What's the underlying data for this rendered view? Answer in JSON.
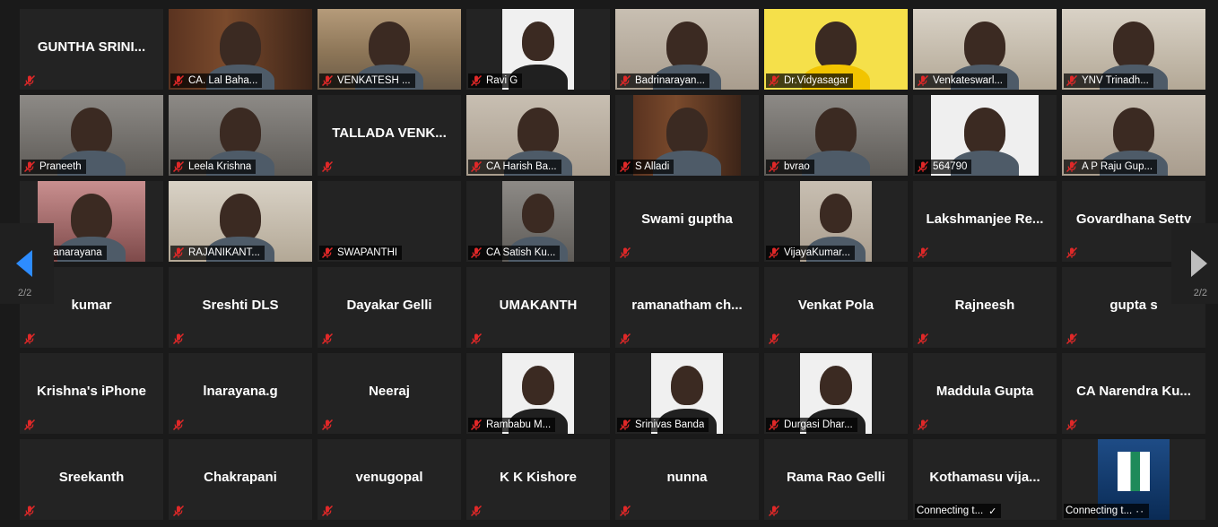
{
  "colors": {
    "background": "#1a1a1a",
    "tile": "#232323",
    "accent_arrow": "#2d8cff",
    "muted_mic": "#e02828"
  },
  "pager": {
    "left_page": "2/2",
    "right_page": "2/2"
  },
  "tiles": [
    {
      "name": "GUNTHA SRINI...",
      "label": "",
      "video": false
    },
    {
      "name": "CA. Lal Baha...",
      "label": "CA. Lal Baha...",
      "video": true,
      "scene": "scene-door"
    },
    {
      "name": "VENKATESH ...",
      "label": "VENKATESH ...",
      "video": true,
      "scene": "scene-shelf"
    },
    {
      "name": "Ravi G",
      "label": "Ravi G",
      "video": true,
      "scene": "scene-portrait",
      "narrow": true
    },
    {
      "name": "Badrinarayan...",
      "label": "Badrinarayan...",
      "video": true,
      "scene": "scene-wall"
    },
    {
      "name": "Dr.Vidyasagar",
      "label": "Dr.Vidyasagar",
      "video": true,
      "scene": "scene-yellow"
    },
    {
      "name": "Venkateswarl...",
      "label": "Venkateswarl...",
      "video": true,
      "scene": "scene-room"
    },
    {
      "name": "YNV Trinadh...",
      "label": "YNV Trinadh...",
      "video": true,
      "scene": "scene-room"
    },
    {
      "name": "Praneeth",
      "label": "Praneeth",
      "video": true,
      "scene": "scene-grey"
    },
    {
      "name": "Leela Krishna",
      "label": "Leela Krishna",
      "video": true,
      "scene": "scene-grey"
    },
    {
      "name": "TALLADA VENK...",
      "label": "",
      "video": false
    },
    {
      "name": "CA Harish Ba...",
      "label": "CA Harish Ba...",
      "video": true,
      "scene": "scene-wall"
    },
    {
      "name": "S Alladi",
      "label": "S Alladi",
      "video": true,
      "scene": "scene-door",
      "narrow": true,
      "wide_narrow": true
    },
    {
      "name": "bvrao",
      "label": "bvrao",
      "video": true,
      "scene": "scene-grey"
    },
    {
      "name": "564790",
      "label": "564790",
      "video": true,
      "scene": "scene-white",
      "narrow": true,
      "wide_narrow": true
    },
    {
      "name": "A P Raju Gup...",
      "label": "A P Raju Gup...",
      "video": true,
      "scene": "scene-wall"
    },
    {
      "name": "...yanarayana",
      "label": "...yanarayana",
      "video": true,
      "scene": "scene-pink",
      "narrow": true,
      "wide_narrow": true
    },
    {
      "name": "RAJANIKANT...",
      "label": "RAJANIKANT...",
      "video": true,
      "scene": "scene-room"
    },
    {
      "name": "SWAPANTHI",
      "label": "SWAPANTHI",
      "video": false,
      "no_big": true
    },
    {
      "name": "CA Satish Ku...",
      "label": "CA Satish Ku...",
      "video": true,
      "scene": "scene-grey",
      "narrow": true
    },
    {
      "name": "Swami guptha",
      "label": "",
      "video": false
    },
    {
      "name": "VijayaKumar...",
      "label": "VijayaKumar...",
      "video": true,
      "scene": "scene-wall",
      "narrow": true
    },
    {
      "name": "Lakshmanjee  Re...",
      "label": "",
      "video": false
    },
    {
      "name": "Govardhana Setty",
      "label": "",
      "video": false
    },
    {
      "name": "kumar",
      "label": "",
      "video": false
    },
    {
      "name": "Sreshti DLS",
      "label": "",
      "video": false
    },
    {
      "name": "Dayakar Gelli",
      "label": "",
      "video": false
    },
    {
      "name": "UMAKANTH",
      "label": "",
      "video": false
    },
    {
      "name": "ramanatham  ch...",
      "label": "",
      "video": false
    },
    {
      "name": "Venkat Pola",
      "label": "",
      "video": false
    },
    {
      "name": "Rajneesh",
      "label": "",
      "video": false
    },
    {
      "name": "gupta s",
      "label": "",
      "video": false
    },
    {
      "name": "Krishna's iPhone",
      "label": "",
      "video": false
    },
    {
      "name": "lnarayana.g",
      "label": "",
      "video": false
    },
    {
      "name": "Neeraj",
      "label": "",
      "video": false
    },
    {
      "name": "Rambabu M...",
      "label": "Rambabu M...",
      "video": true,
      "scene": "scene-portrait",
      "narrow": true
    },
    {
      "name": "Srinivas Banda",
      "label": "Srinivas Banda",
      "video": true,
      "scene": "scene-portrait",
      "narrow": true
    },
    {
      "name": "Durgasi Dhar...",
      "label": "Durgasi Dhar...",
      "video": true,
      "scene": "scene-portrait",
      "narrow": true
    },
    {
      "name": "Maddula Gupta",
      "label": "",
      "video": false
    },
    {
      "name": "CA Narendra Ku...",
      "label": "",
      "video": false
    },
    {
      "name": "Sreekanth",
      "label": "",
      "video": false
    },
    {
      "name": "Chakrapani",
      "label": "",
      "video": false
    },
    {
      "name": "venugopal",
      "label": "",
      "video": false
    },
    {
      "name": "K K Kishore",
      "label": "",
      "video": false
    },
    {
      "name": "nunna",
      "label": "",
      "video": false
    },
    {
      "name": "Rama Rao Gelli",
      "label": "",
      "video": false
    },
    {
      "name": "Kothamasu  vija...",
      "label": "Connecting t...",
      "video": false,
      "connecting": true,
      "status_icon": "check"
    },
    {
      "name": "",
      "label": "Connecting t...",
      "video": true,
      "scene": "scene-blue",
      "narrow": true,
      "connecting": true,
      "status_icon": "dots"
    }
  ]
}
